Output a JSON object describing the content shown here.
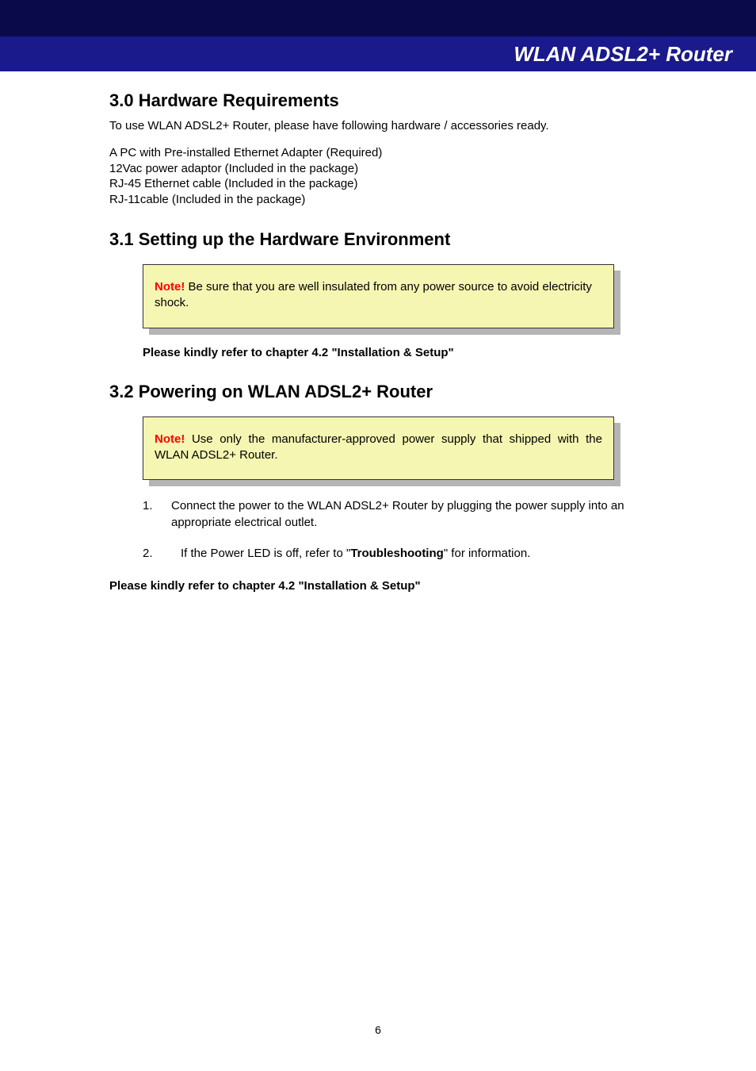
{
  "header": {
    "title": "WLAN ADSL2+ Router"
  },
  "sections": {
    "s30": {
      "heading": "3.0 Hardware Requirements",
      "intro": "To use WLAN ADSL2+ Router, please have following hardware / accessories ready.",
      "items": {
        "i0": "A PC with Pre-installed Ethernet Adapter (Required)",
        "i1": "12Vac power adaptor (Included in the package)",
        "i2": "RJ-45 Ethernet cable (Included in the package)",
        "i3": "RJ-11cable (Included in the package)"
      }
    },
    "s31": {
      "heading": "3.1 Setting up the Hardware Environment",
      "note_label": "Note!",
      "note_text": " Be sure that you are well insulated from any power source to avoid electricity shock.",
      "refer": "Please kindly refer to chapter 4.2 \"Installation & Setup\""
    },
    "s32": {
      "heading": "3.2 Powering on WLAN ADSL2+ Router",
      "note_label": "Note!",
      "note_text": " Use only the manufacturer-approved power supply that shipped with the WLAN ADSL2+ Router.",
      "steps": {
        "n1": "1.",
        "t1": "Connect the power to the WLAN ADSL2+ Router by plugging the power supply into an appropriate electrical outlet.",
        "n2": "2.",
        "t2a": " If the Power LED is off, refer to \"",
        "t2b": "Troubleshooting",
        "t2c": "\" for information."
      },
      "refer": "Please kindly refer to chapter 4.2 \"Installation & Setup\""
    }
  },
  "page_number": "6"
}
